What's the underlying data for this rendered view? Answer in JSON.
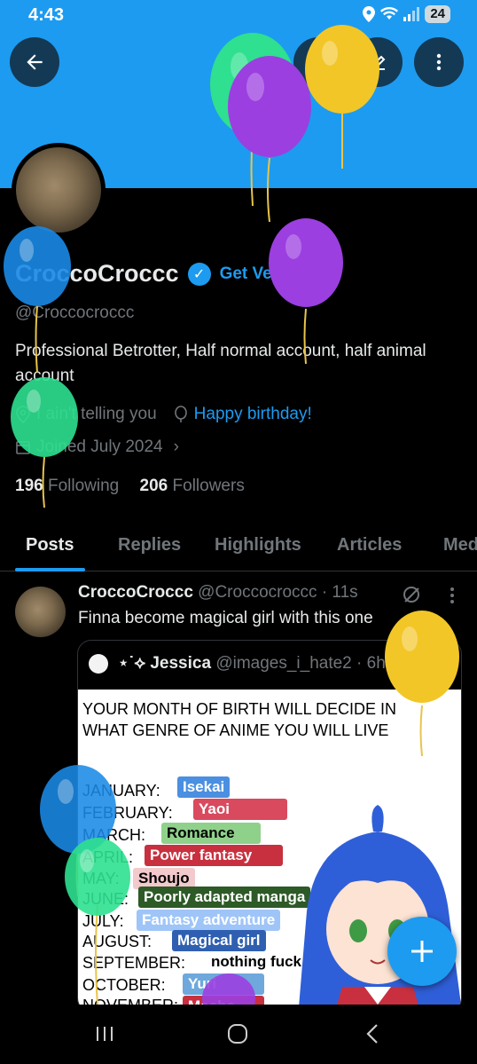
{
  "status_bar": {
    "time": "4:43",
    "battery": "24"
  },
  "header": {
    "back_icon": "arrow-left-icon",
    "action_icons": [
      "search-icon",
      "edit-icon",
      "more-vertical-icon"
    ]
  },
  "profile": {
    "name": "CroccoCroccc",
    "get_verified": "Get Verified",
    "handle": "@Croccocroccc",
    "bio": "Professional Betrotter, Half normal account, half animal account",
    "location": "I ain't telling you",
    "birthday": "Happy birthday!",
    "joined": "Joined July 2024",
    "following_count": "196",
    "following_label": "Following",
    "followers_count": "206",
    "followers_label": "Followers"
  },
  "tabs": [
    "Posts",
    "Replies",
    "Highlights",
    "Articles",
    "Media"
  ],
  "active_tab": "Posts",
  "tweet": {
    "author": "CroccoCroccc",
    "handle_time": "@Croccocroccc · 11s",
    "text": "Finna become magical girl with this one",
    "quote": {
      "prefix": "⋆˙⟡",
      "author": "Jessica",
      "handle_time": "@images_i_hate2 · 6h",
      "image": {
        "heading": "YOUR MONTH OF BIRTH WILL DECIDE IN WHAT GENRE OF ANIME YOU WILL LIVE",
        "months": [
          "JANUARY:",
          "FEBRUARY:",
          "MARCH:",
          "APRIL:",
          "MAY:",
          "JUNE:",
          "JULY:",
          "AUGUST:",
          "SEPTEMBER:",
          "OCTOBER:",
          "NOVEMBER:"
        ],
        "genres": [
          {
            "label": "Isekai",
            "color": "#4a8fe0"
          },
          {
            "label": "Yaoi",
            "color": "#d94a5e"
          },
          {
            "label": "Romance",
            "color": "#8fd18a"
          },
          {
            "label": "Power fantasy",
            "color": "#c8303f"
          },
          {
            "label": "Shoujo",
            "color": "#f2c9cc"
          },
          {
            "label": "Poorly adapted manga",
            "color": "#2d5a27"
          },
          {
            "label": "Fantasy adventure",
            "color": "#9fc5f8"
          },
          {
            "label": "Magical girl",
            "color": "#2f5fb0"
          },
          {
            "label": "nothing fuck off",
            "color": "#ffffff"
          },
          {
            "label": "Yuri",
            "color": "#6fa8dc"
          },
          {
            "label": "Mecha",
            "color": "#c8303f"
          }
        ]
      }
    }
  },
  "colors": {
    "accent": "#1d9bf0",
    "background": "#000000",
    "muted": "#71767b"
  },
  "fab_icon": "plus-icon",
  "nav_icons": [
    "recent-apps-icon",
    "home-circle-icon",
    "back-chevron-icon"
  ],
  "balloon_colors": [
    "#2ee08f",
    "#9b3fe0",
    "#f2c627",
    "#1a8ae6"
  ]
}
